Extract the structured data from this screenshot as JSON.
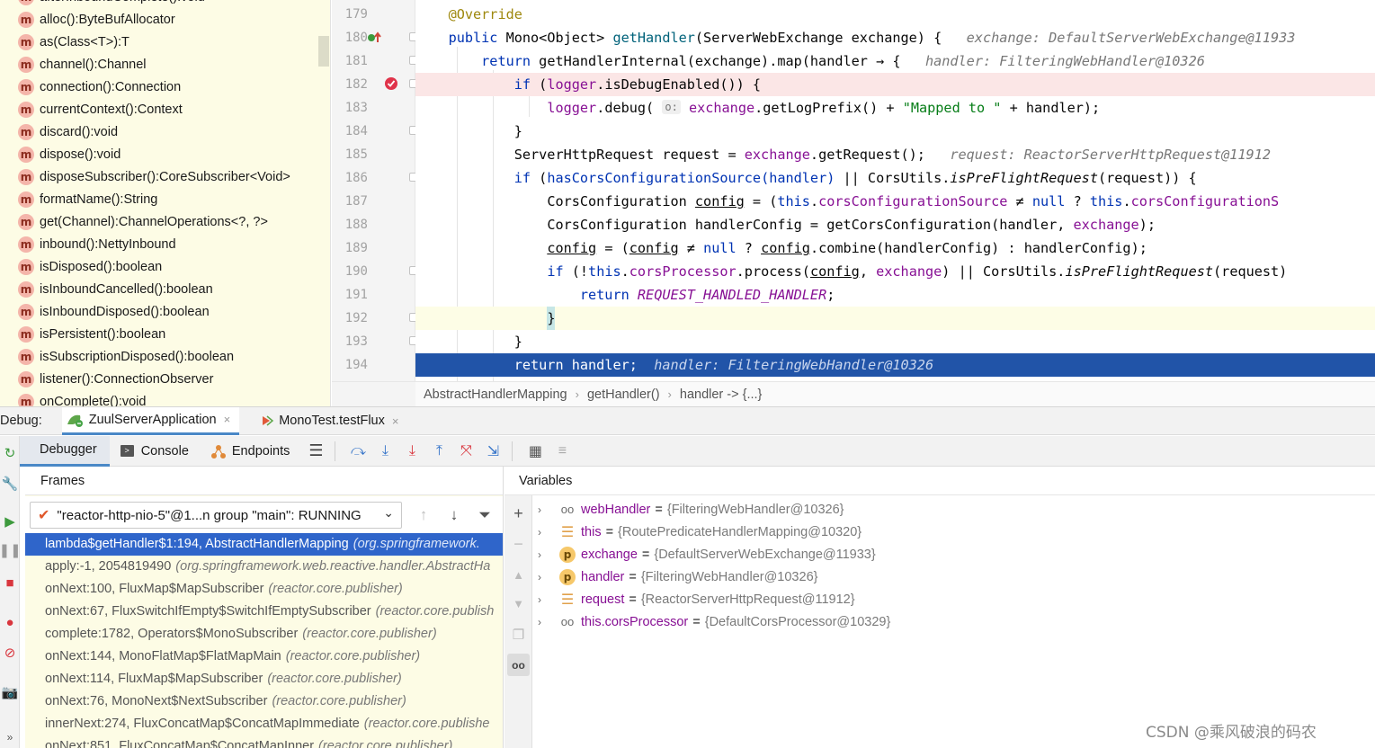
{
  "structure": {
    "items": [
      {
        "label": "afterInboundComplete():void"
      },
      {
        "label": "alloc():ByteBufAllocator"
      },
      {
        "label": "as(Class<T>):T"
      },
      {
        "label": "channel():Channel"
      },
      {
        "label": "connection():Connection"
      },
      {
        "label": "currentContext():Context"
      },
      {
        "label": "discard():void"
      },
      {
        "label": "dispose():void"
      },
      {
        "label": "disposeSubscriber():CoreSubscriber<Void>"
      },
      {
        "label": "formatName():String"
      },
      {
        "label": "get(Channel):ChannelOperations<?, ?>"
      },
      {
        "label": "inbound():NettyInbound"
      },
      {
        "label": "isDisposed():boolean"
      },
      {
        "label": "isInboundCancelled():boolean"
      },
      {
        "label": "isInboundDisposed():boolean"
      },
      {
        "label": "isPersistent():boolean"
      },
      {
        "label": "isSubscriptionDisposed():boolean"
      },
      {
        "label": "listener():ConnectionObserver"
      },
      {
        "label": "onComplete():void"
      }
    ],
    "method_badge": "m"
  },
  "editor": {
    "lines": [
      {
        "num": "179"
      },
      {
        "num": "180"
      },
      {
        "num": "181"
      },
      {
        "num": "182"
      },
      {
        "num": "183"
      },
      {
        "num": "184"
      },
      {
        "num": "185"
      },
      {
        "num": "186"
      },
      {
        "num": "187"
      },
      {
        "num": "188"
      },
      {
        "num": "189"
      },
      {
        "num": "190"
      },
      {
        "num": "191"
      },
      {
        "num": "192"
      },
      {
        "num": "193"
      },
      {
        "num": "194"
      }
    ],
    "code": {
      "l179_ann": "@Override",
      "l180_a": "public",
      "l180_b": " Mono<Object> ",
      "l180_c": "getHandler",
      "l180_d": "(ServerWebExchange exchange) {",
      "l180_hint": "exchange: DefaultServerWebExchange@11933",
      "l181_kw": "return",
      "l181_b": " getHandlerInternal(exchange).map(handler ",
      "l181_arrow": "→",
      "l181_c": " {",
      "l181_hint": "handler: FilteringWebHandler@10326",
      "l182_kw": "if",
      "l182_b": " (",
      "l182_fld": "logger",
      "l182_c": ".isDebugEnabled()) {",
      "l183_fld": "logger",
      "l183_b": ".debug(",
      "l183_param": "o:",
      "l183_c": "exchange",
      "l183_d": ".getLogPrefix() + ",
      "l183_str": "\"Mapped to \"",
      "l183_e": " + handler);",
      "l184": "}",
      "l185_a": "ServerHttpRequest request = ",
      "l185_b": "exchange",
      "l185_c": ".getRequest();",
      "l185_hint": "request: ReactorServerHttpRequest@11912",
      "l186_kw": "if",
      "l186_b": " (",
      "l186_c": "hasCorsConfigurationSource(handler)",
      "l186_d": " || CorsUtils.",
      "l186_e": "isPreFlightRequest",
      "l186_f": "(request)) {",
      "l187_a": "CorsConfiguration ",
      "l187_b": "config",
      "l187_c": " = (",
      "l187_kw": "this",
      "l187_d": ".",
      "l187_fld": "corsConfigurationSource",
      "l187_e": " ≠ ",
      "l187_kw2": "null",
      "l187_f": " ? ",
      "l187_kw3": "this",
      "l187_g": ".",
      "l187_fld2": "corsConfigurationS",
      "l188_a": "CorsConfiguration handlerConfig = getCorsConfiguration(handler, ",
      "l188_b": "exchange",
      "l188_c": ");",
      "l189_a": "config",
      "l189_b": " = (",
      "l189_c": "config",
      "l189_d": " ≠ ",
      "l189_kw": "null",
      "l189_e": " ? ",
      "l189_f": "config",
      "l189_g": ".combine(handlerConfig) : handlerConfig);",
      "l190_kw": "if",
      "l190_b": " (!",
      "l190_kw2": "this",
      "l190_c": ".",
      "l190_fld": "corsProcessor",
      "l190_d": ".process(",
      "l190_e": "config",
      "l190_f": ", ",
      "l190_g": "exchange",
      "l190_h": ") || CorsUtils.",
      "l190_i": "isPreFlightRequest",
      "l190_j": "(request)",
      "l191_kw": "return",
      "l191_fld": "REQUEST_HANDLED_HANDLER",
      "l191_c": ";",
      "l192": "}",
      "l193": "}",
      "l194_kw": "return",
      "l194_b": " handler;",
      "l194_hint": "handler: FilteringWebHandler@10326"
    }
  },
  "breadcrumb": [
    "AbstractHandlerMapping",
    "getHandler()",
    "handler -> {...}"
  ],
  "debug": {
    "label": "Debug:",
    "tabs": [
      {
        "label": "ZuulServerApplication",
        "close": "×"
      },
      {
        "label": "MonoTest.testFlux",
        "close": "×"
      }
    ],
    "subtabs": {
      "debugger": "Debugger",
      "console": "Console",
      "endpoints": "Endpoints"
    },
    "frames_title": "Frames",
    "variables_title": "Variables",
    "thread": "\"reactor-http-nio-5\"@1...n group \"main\": RUNNING",
    "frames": [
      {
        "method": "lambda$getHandler$1:194, AbstractHandlerMapping",
        "pkg": "(org.springframework."
      },
      {
        "method": "apply:-1, 2054819490",
        "pkg": "(org.springframework.web.reactive.handler.AbstractHa"
      },
      {
        "method": "onNext:100, FluxMap$MapSubscriber",
        "pkg": "(reactor.core.publisher)"
      },
      {
        "method": "onNext:67, FluxSwitchIfEmpty$SwitchIfEmptySubscriber",
        "pkg": "(reactor.core.publish"
      },
      {
        "method": "complete:1782, Operators$MonoSubscriber",
        "pkg": "(reactor.core.publisher)"
      },
      {
        "method": "onNext:144, MonoFlatMap$FlatMapMain",
        "pkg": "(reactor.core.publisher)"
      },
      {
        "method": "onNext:114, FluxMap$MapSubscriber",
        "pkg": "(reactor.core.publisher)"
      },
      {
        "method": "onNext:76, MonoNext$NextSubscriber",
        "pkg": "(reactor.core.publisher)"
      },
      {
        "method": "innerNext:274, FluxConcatMap$ConcatMapImmediate",
        "pkg": "(reactor.core.publishe"
      },
      {
        "method": "onNext:851, FluxConcatMap$ConcatMapInner",
        "pkg": "(reactor.core.publisher)"
      }
    ],
    "variables": [
      {
        "icon": "glasses-icon",
        "badge": "oo",
        "name": "webHandler",
        "value": "{FilteringWebHandler@10326}"
      },
      {
        "icon": "fields-icon",
        "badge": "☰",
        "name": "this",
        "value": "{RoutePredicateHandlerMapping@10320}"
      },
      {
        "icon": "param-icon",
        "badge": "p",
        "name": "exchange",
        "value": "{DefaultServerWebExchange@11933}"
      },
      {
        "icon": "param-icon",
        "badge": "p",
        "name": "handler",
        "value": "{FilteringWebHandler@10326}"
      },
      {
        "icon": "fields-icon",
        "badge": "☰",
        "name": "request",
        "value": "{ReactorServerHttpRequest@11912}"
      },
      {
        "icon": "glasses-icon",
        "badge": "oo",
        "name": "this.corsProcessor",
        "value": "{DefaultCorsProcessor@10329}"
      }
    ],
    "equals": "="
  },
  "watermark": "CSDN @乘风破浪的码农",
  "colors": {
    "accent": "#2f65ca",
    "exec_line": "#2154a8",
    "breakpoint": "#e0334a",
    "frames_bg": "#fdfce5"
  }
}
